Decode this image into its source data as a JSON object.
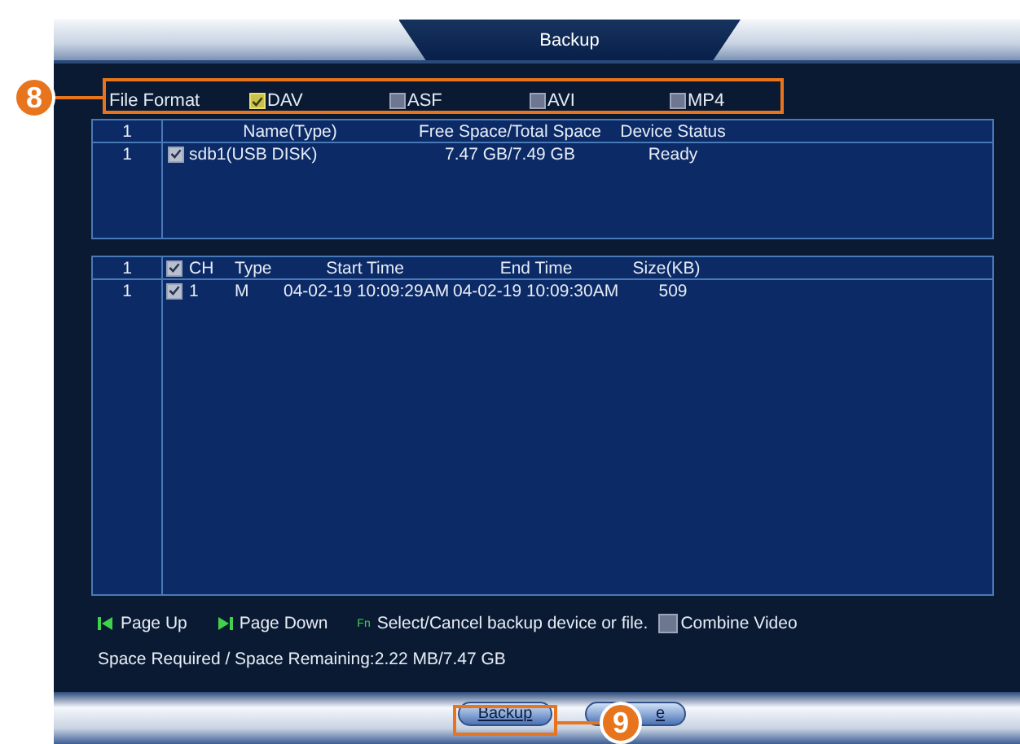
{
  "window": {
    "title": "Backup"
  },
  "callouts": [
    {
      "label": "8"
    },
    {
      "label": "9"
    }
  ],
  "file_format": {
    "label": "File Format",
    "options": [
      {
        "label": "DAV",
        "checked": true
      },
      {
        "label": "ASF",
        "checked": false
      },
      {
        "label": "AVI",
        "checked": false
      },
      {
        "label": "MP4",
        "checked": false
      }
    ]
  },
  "devices": {
    "columns": [
      "1",
      "Name(Type)",
      "Free Space/Total Space",
      "Device Status"
    ],
    "rows": [
      {
        "index": "1",
        "checked": true,
        "name": "sdb1(USB DISK)",
        "space": "7.47 GB/7.49 GB",
        "status": "Ready"
      }
    ]
  },
  "files": {
    "header_index": "1",
    "header_checked": true,
    "columns": [
      "CH",
      "Type",
      "Start Time",
      "End Time",
      "Size(KB)"
    ],
    "rows": [
      {
        "index": "1",
        "checked": true,
        "ch": "1",
        "type": "M",
        "start": "04-02-19 10:09:29AM",
        "end": "04-02-19 10:09:30AM",
        "size": "509"
      }
    ]
  },
  "hints": [
    {
      "kind": "page_up",
      "label": "Page Up"
    },
    {
      "kind": "page_down",
      "label": "Page Down"
    },
    {
      "kind": "fn",
      "icon": "Fn",
      "label": "Select/Cancel backup device or file."
    }
  ],
  "combine_video": {
    "label": "Combine Video",
    "checked": false
  },
  "space": "Space Required / Space Remaining:2.22 MB/7.47 GB",
  "buttons": [
    {
      "label": "Backup"
    },
    {
      "label": "e"
    }
  ]
}
